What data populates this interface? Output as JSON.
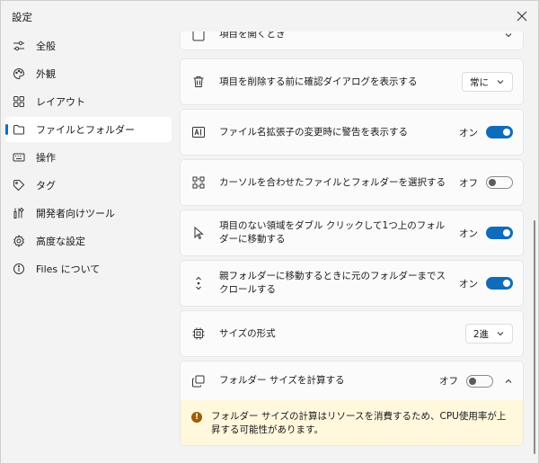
{
  "window": {
    "title": "設定"
  },
  "sidebar": {
    "items": [
      {
        "label": "全般",
        "icon": "sliders-icon"
      },
      {
        "label": "外観",
        "icon": "palette-icon"
      },
      {
        "label": "レイアウト",
        "icon": "grid-icon"
      },
      {
        "label": "ファイルとフォルダー",
        "icon": "folder-icon",
        "selected": true
      },
      {
        "label": "操作",
        "icon": "keyboard-icon"
      },
      {
        "label": "タグ",
        "icon": "tag-icon"
      },
      {
        "label": "開発者向けツール",
        "icon": "toolbox-icon"
      },
      {
        "label": "高度な設定",
        "icon": "cog-icon"
      },
      {
        "label": "Files について",
        "icon": "info-icon"
      }
    ]
  },
  "settings": {
    "partial_row": {
      "label": "項目を開くとき"
    },
    "confirm_delete": {
      "label": "項目を削除する前に確認ダイアログを表示する",
      "value": "常に"
    },
    "extension_warning": {
      "label": "ファイル名拡張子の変更時に警告を表示する",
      "state": "オン"
    },
    "select_hover": {
      "label": "カーソルを合わせたファイルとフォルダーを選択する",
      "state": "オフ"
    },
    "double_click_up": {
      "label": "項目のない領域をダブル クリックして1つ上のフォルダーに移動する",
      "state": "オン"
    },
    "scroll_to_prev": {
      "label": "親フォルダーに移動するときに元のフォルダーまでスクロールする",
      "state": "オン"
    },
    "size_format": {
      "label": "サイズの形式",
      "value": "2進"
    },
    "calc_folder_size": {
      "label": "フォルダー サイズを計算する",
      "state": "オフ",
      "warning": "フォルダー サイズの計算はリソースを消費するため、CPU使用率が上昇する可能性があります。"
    }
  },
  "colors": {
    "accent": "#0f6cbd",
    "warning_bg": "#fff8dd",
    "warning_icon": "#9d5d00"
  }
}
